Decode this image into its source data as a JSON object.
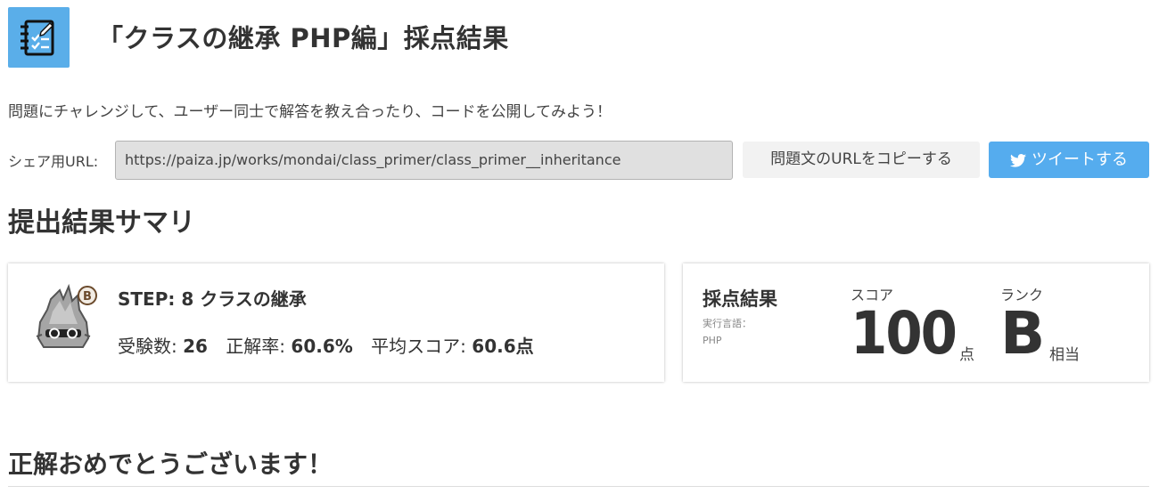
{
  "header": {
    "icon": "notebook-checklist-icon",
    "title": "「クラスの継承 PHP編」採点結果"
  },
  "intro_text": "問題にチャレンジして、ユーザー同士で解答を教え合ったり、コードを公開してみよう！",
  "share": {
    "label": "シェア用URL:",
    "url": "https://paiza.jp/works/mondai/class_primer/class_primer__inheritance",
    "copy_button": "問題文のURLをコピーする",
    "tweet_button": "ツイートする",
    "tweet_icon": "twitter-bird-icon"
  },
  "summary": {
    "title": "提出結果サマリ",
    "step_card": {
      "mascot_icon": "paiza-mascot-rank-b-icon",
      "rank_badge": "B",
      "step_title": "STEP: 8 クラスの継承",
      "examinees_label": "受験数:",
      "examinees_value": "26",
      "accuracy_label": "正解率:",
      "accuracy_value": "60.6%",
      "avg_score_label": "平均スコア:",
      "avg_score_value": "60.6点"
    },
    "score_card": {
      "heading": "採点結果",
      "language_label": "実行言語：",
      "language_value": "PHP",
      "score_label": "スコア",
      "score_value": "100",
      "score_unit": "点",
      "rank_label": "ランク",
      "rank_value": "B",
      "rank_suffix": "相当"
    }
  },
  "congrats_text": "正解おめでとうございます！",
  "colors": {
    "accent_blue": "#5aaee9",
    "tweet_blue": "#55acee",
    "url_field_bg": "#e0e0e0",
    "text": "#333333"
  }
}
